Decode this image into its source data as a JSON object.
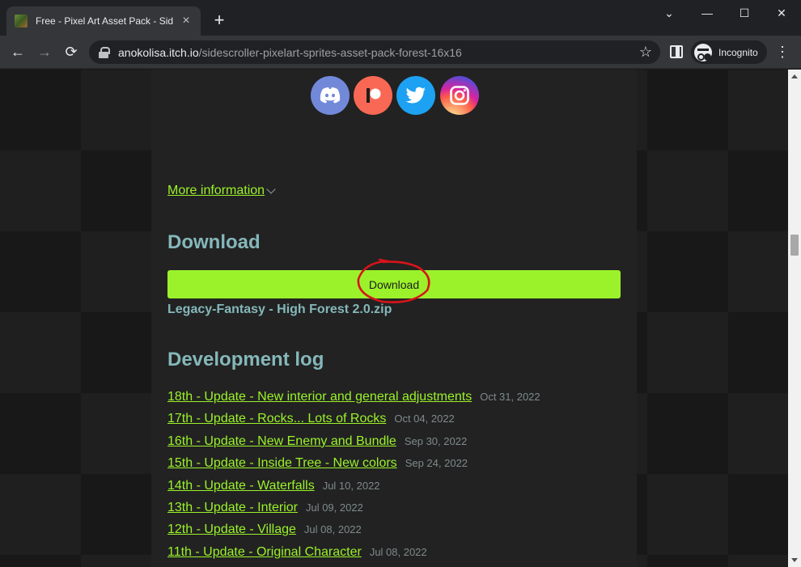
{
  "browser": {
    "tab_title": "Free - Pixel Art Asset Pack - Side",
    "tab_close": "×",
    "new_tab": "+",
    "url_host": "anokolisa.itch.io",
    "url_path": "/sidescroller-pixelart-sprites-asset-pack-forest-16x16",
    "incognito_label": "Incognito",
    "win_minimize": "⌄",
    "win_min": "—",
    "win_max": "☐",
    "win_close": "✕",
    "back": "←",
    "forward": "→",
    "reload": "⟳",
    "bookmark": "☆",
    "menu": "⋮"
  },
  "social": [
    {
      "name": "discord",
      "icon": "discord-icon",
      "color": "#7289da"
    },
    {
      "name": "patreon",
      "icon": "patreon-icon",
      "color": "#f96854"
    },
    {
      "name": "twitter",
      "icon": "twitter-icon",
      "color": "#1da1f2"
    },
    {
      "name": "instagram",
      "icon": "instagram-icon",
      "color": "#d6249f"
    }
  ],
  "page": {
    "more_info": "More information",
    "download_heading": "Download",
    "download_button": "Download",
    "download_file": "Legacy-Fantasy - High Forest 2.0.zip",
    "devlog_heading": "Development log",
    "devlog": [
      {
        "title": "18th - Update - New interior and general adjustments",
        "date": "Oct 31, 2022"
      },
      {
        "title": "17th - Update - Rocks... Lots of Rocks",
        "date": "Oct 04, 2022"
      },
      {
        "title": "16th - Update - New Enemy and Bundle",
        "date": "Sep 30, 2022"
      },
      {
        "title": "15th - Update - Inside Tree - New colors",
        "date": "Sep 24, 2022"
      },
      {
        "title": "14th - Update - Waterfalls",
        "date": "Jul 10, 2022"
      },
      {
        "title": "13th - Update - Interior",
        "date": "Jul 09, 2022"
      },
      {
        "title": "12th - Update - Village",
        "date": "Jul 08, 2022"
      },
      {
        "title": "11th - Update - Original Character",
        "date": "Jul 08, 2022"
      }
    ]
  },
  "colors": {
    "accent": "#9bf22a",
    "heading": "#85b7b9",
    "annotation": "#d7141a"
  }
}
